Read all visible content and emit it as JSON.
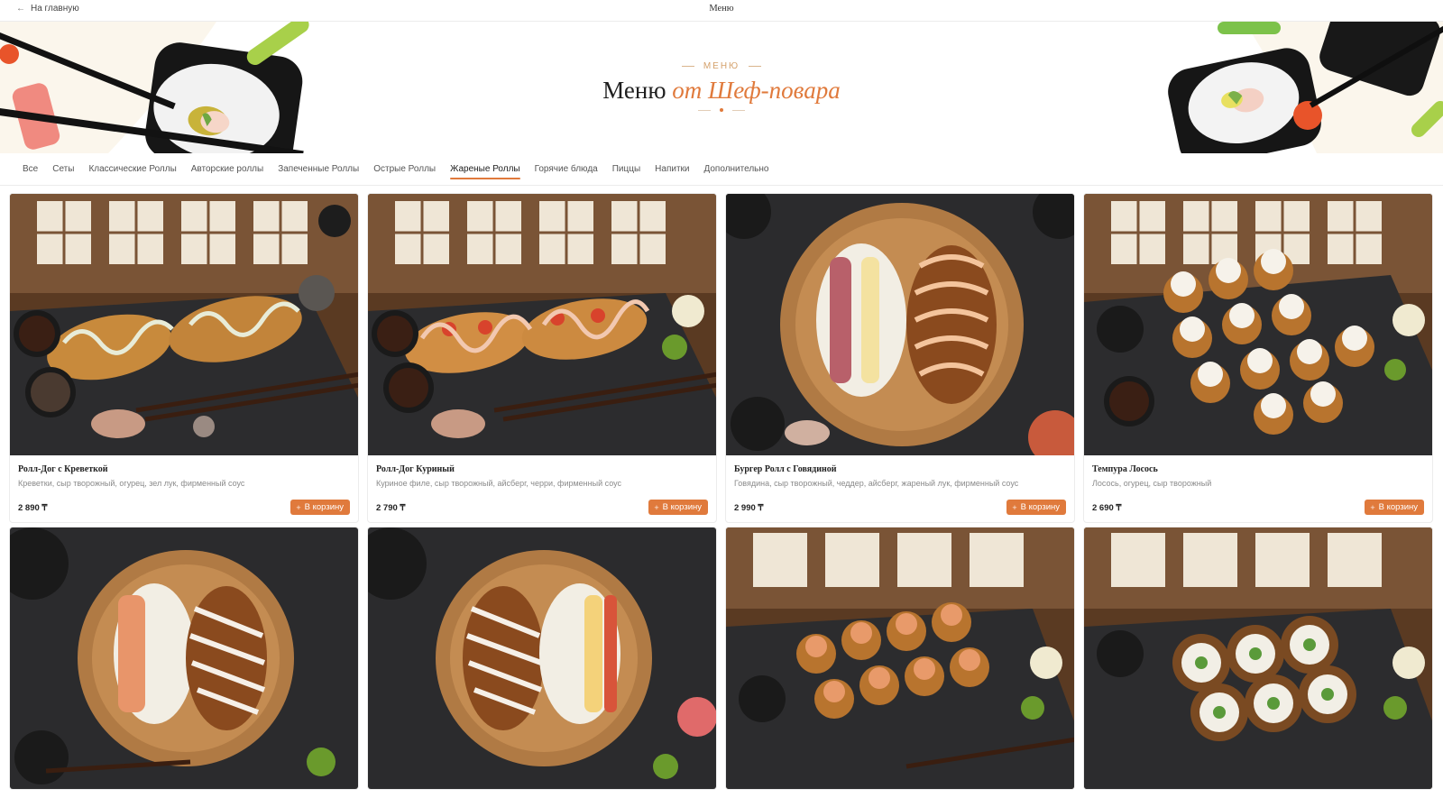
{
  "topbar": {
    "back_label": "На главную",
    "title": "Меню"
  },
  "hero": {
    "eyebrow": "МЕНЮ",
    "title_main": "Меню",
    "title_accent": "от Шеф-повара"
  },
  "tabs": [
    {
      "label": "Все",
      "active": false
    },
    {
      "label": "Сеты",
      "active": false
    },
    {
      "label": "Классические Роллы",
      "active": false
    },
    {
      "label": "Авторские роллы",
      "active": false
    },
    {
      "label": "Запеченные Роллы",
      "active": false
    },
    {
      "label": "Острые Роллы",
      "active": false
    },
    {
      "label": "Жареные Роллы",
      "active": true
    },
    {
      "label": "Горячие блюда",
      "active": false
    },
    {
      "label": "Пиццы",
      "active": false
    },
    {
      "label": "Напитки",
      "active": false
    },
    {
      "label": "Дополнительно",
      "active": false
    }
  ],
  "cart_label": "В корзину",
  "products": [
    {
      "name": "Ролл-Дог с Креветкой",
      "description": "Креветки, сыр творожный, огурец, зел лук, фирменный соус",
      "price": "2 890 ₸"
    },
    {
      "name": "Ролл-Дог Куриный",
      "description": "Куриное филе, сыр творожный, айсберг, черри, фирменный соус",
      "price": "2 790 ₸"
    },
    {
      "name": "Бургер Ролл с Говядиной",
      "description": "Говядина, сыр творожный, чеддер, айсберг, жареный лук, фирменный соус",
      "price": "2 990 ₸"
    },
    {
      "name": "Темпура Лосось",
      "description": "Лосось, огурец, сыр творожный",
      "price": "2 690 ₸"
    }
  ],
  "colors": {
    "accent": "#e07a3c",
    "text": "#2a2a2a",
    "muted": "#8a8a8a"
  }
}
